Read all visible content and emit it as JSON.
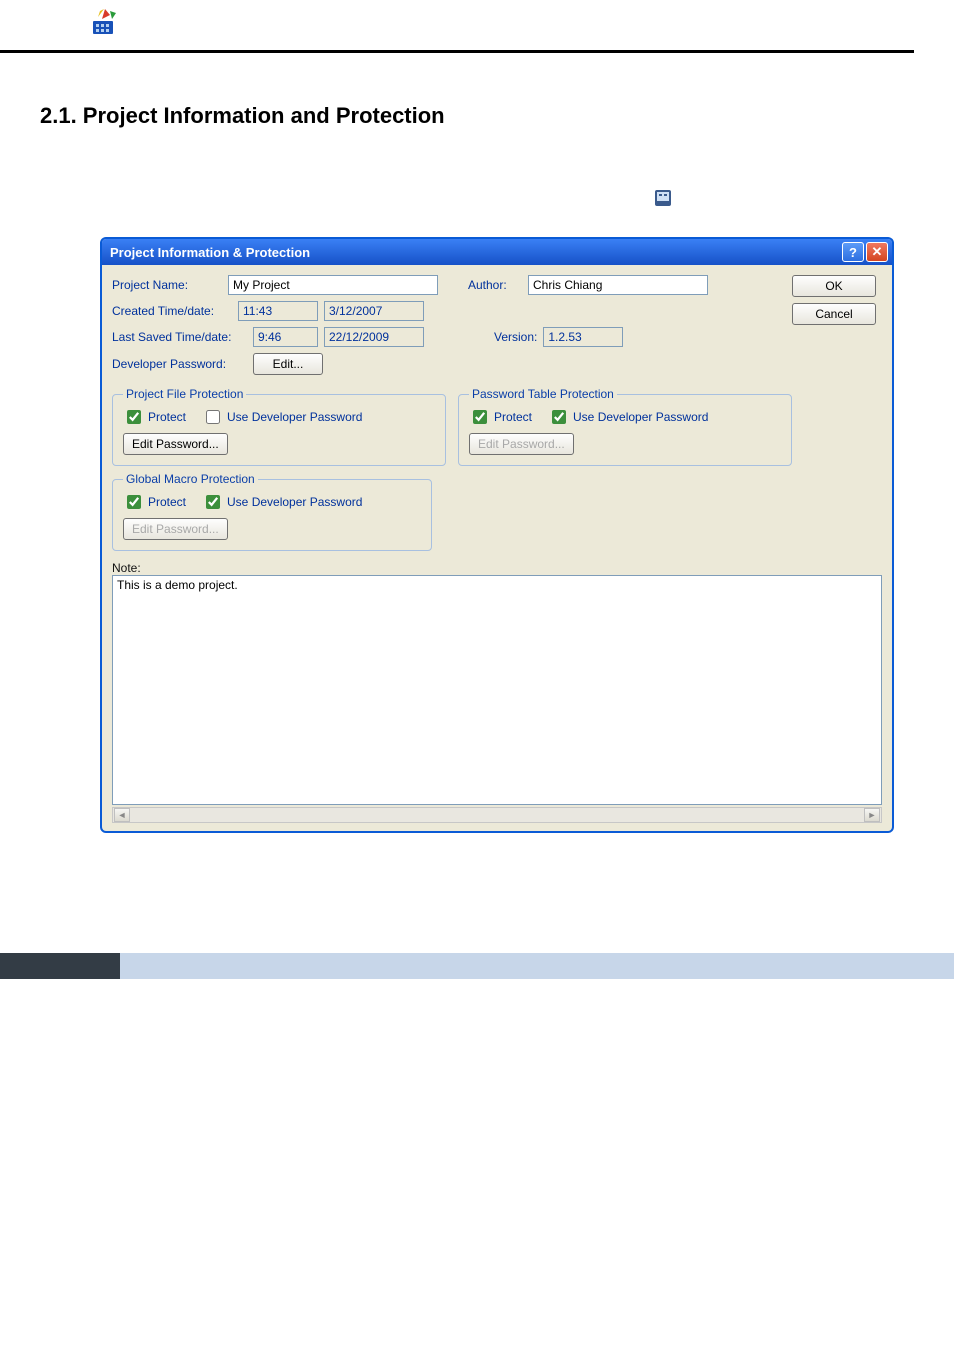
{
  "section_number": "2",
  "section_heading": "2.1. Project Information and Protection",
  "dialog": {
    "title": "Project Information & Protection",
    "ok_label": "OK",
    "cancel_label": "Cancel",
    "project_name_label": "Project Name:",
    "project_name_value": "My Project",
    "author_label": "Author:",
    "author_value": "Chris Chiang",
    "created_label": "Created Time/date:",
    "created_time": "11:43",
    "created_date": "3/12/2007",
    "saved_label": "Last Saved Time/date:",
    "saved_time": "9:46",
    "saved_date": "22/12/2009",
    "version_label": "Version:",
    "version_value": "1.2.53",
    "dev_pw_label": "Developer Password:",
    "edit_label": "Edit...",
    "pfp": {
      "legend": "Project File Protection",
      "protect_label": "Protect",
      "protect_checked": true,
      "usedev_label": "Use Developer Password",
      "usedev_checked": false,
      "editpw_label": "Edit Password...",
      "editpw_enabled": true
    },
    "ptp": {
      "legend": "Password Table Protection",
      "protect_label": "Protect",
      "protect_checked": true,
      "usedev_label": "Use Developer Password",
      "usedev_checked": true,
      "editpw_label": "Edit Password...",
      "editpw_enabled": false
    },
    "gmp": {
      "legend": "Global Macro Protection",
      "protect_label": "Protect",
      "protect_checked": true,
      "usedev_label": "Use Developer Password",
      "usedev_checked": true,
      "editpw_label": "Edit Password...",
      "editpw_enabled": false
    },
    "note_label": "Note:",
    "note_value": "This is a demo project."
  }
}
